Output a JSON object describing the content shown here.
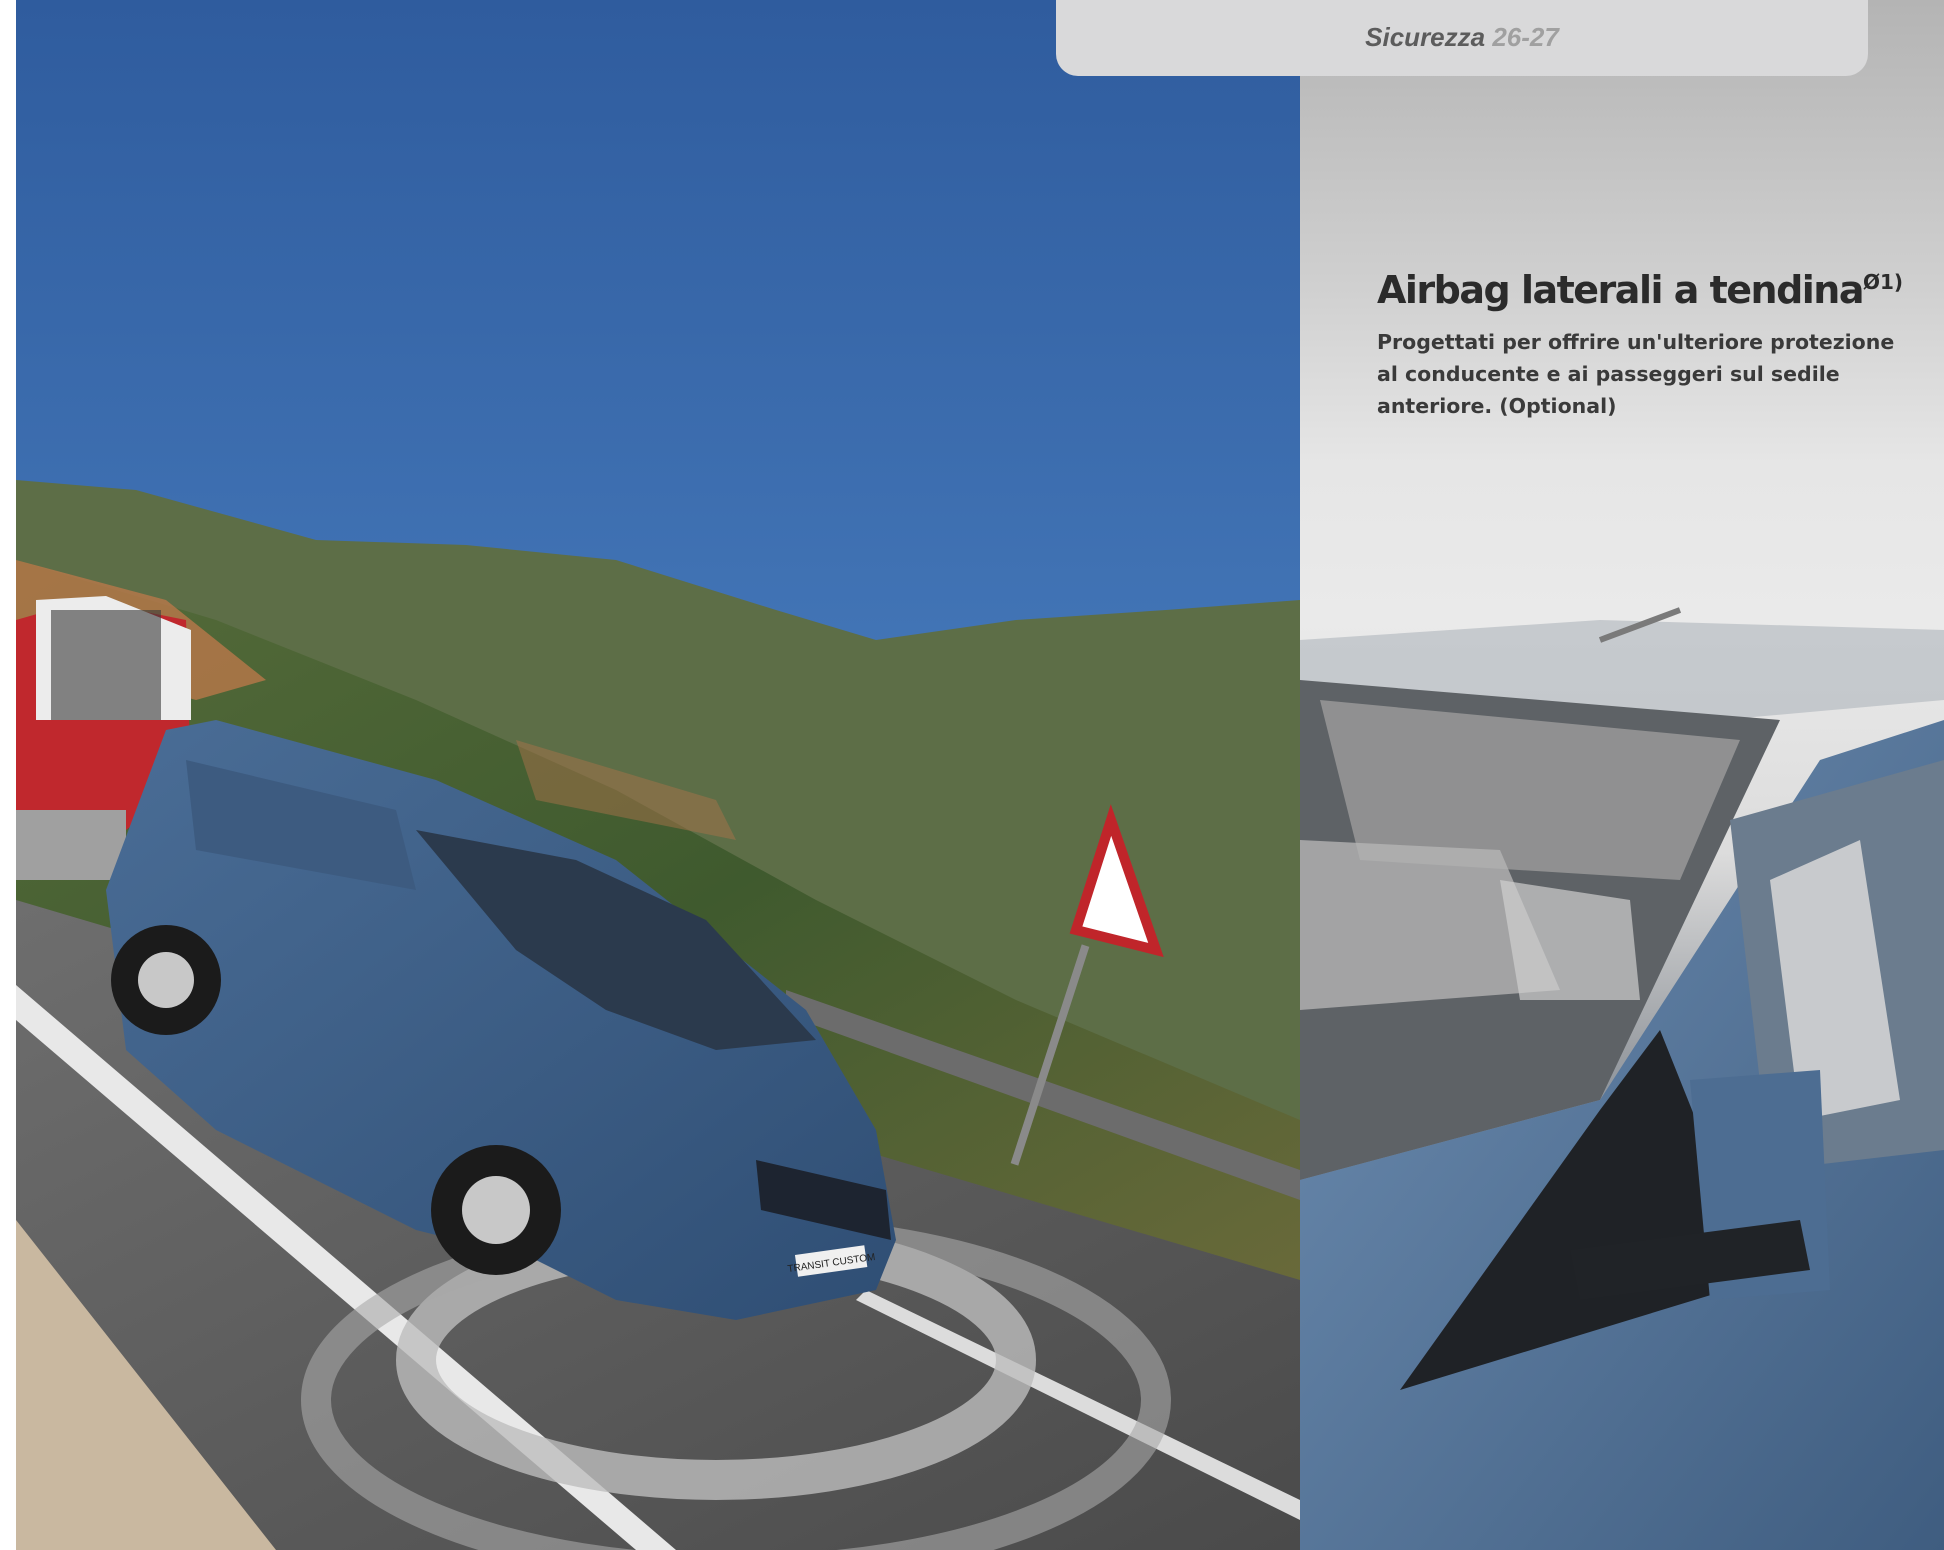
{
  "header": {
    "section": "Sicurezza",
    "pages": "26-27"
  },
  "feature": {
    "title": "Airbag laterali a tendina",
    "footnote": "Ø1)",
    "description": "Progettati per offrire un'ulteriore protezione al conducente e ai passeggeri sul sedile anteriore. (Optional)"
  },
  "images": {
    "left": "van-towing-trailer-on-mountain-road-photo",
    "right": "deployed-curtain-airbag-interior-photo"
  },
  "van_plate": "TRANSIT CUSTOM"
}
